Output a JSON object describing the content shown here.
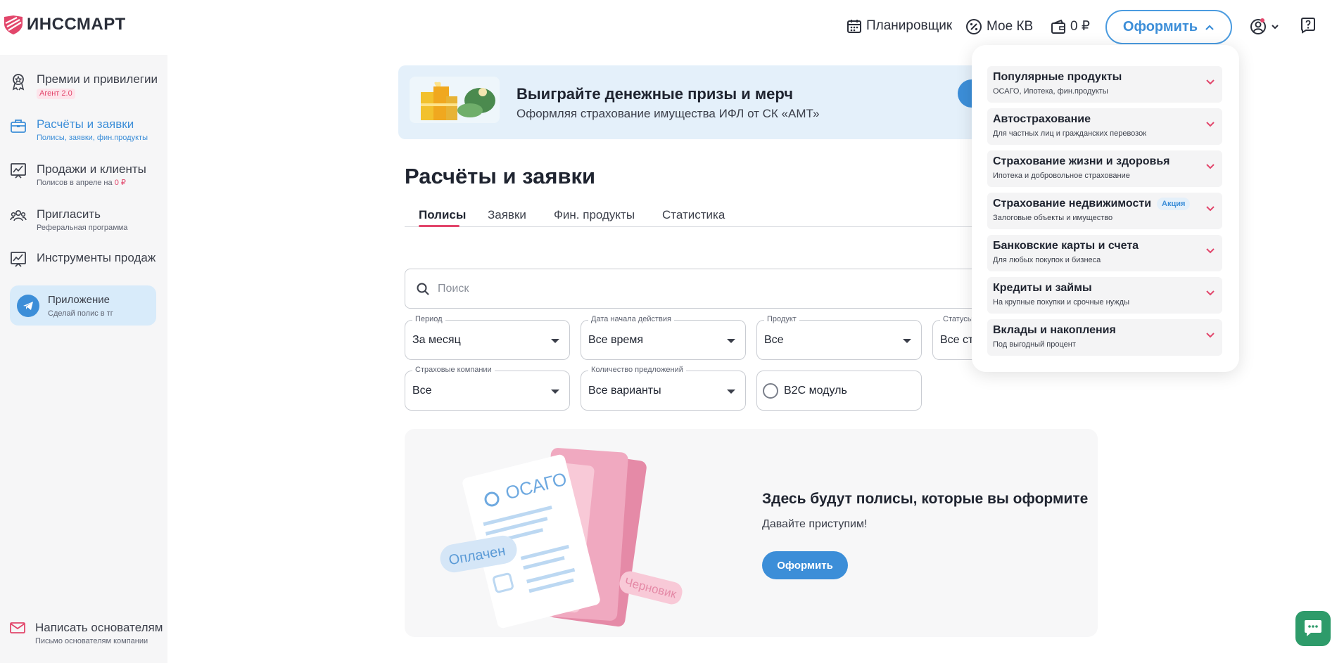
{
  "brand": {
    "name": "ИНССМАРТ",
    "pink": "#e2466b",
    "blue": "#3c8ed8"
  },
  "header": {
    "planner": "Планировщик",
    "my_kv": "Мое КВ",
    "wallet": "0 ₽",
    "oformit": "Оформить"
  },
  "sidebar": {
    "items": [
      {
        "title": "Премии и привилегии",
        "sub": "Агент 2.0"
      },
      {
        "title": "Расчёты и заявки",
        "sub": "Полисы, заявки, фин.продукты"
      },
      {
        "title": "Продажи и клиенты",
        "sub": "Полисов в апреле на",
        "sub_value": "0 ₽"
      },
      {
        "title": "Пригласить",
        "sub": "Реферальная программа"
      },
      {
        "title": "Инструменты продаж",
        "sub": ""
      }
    ],
    "app": {
      "title": "Приложение",
      "sub": "Сделай полис в тг"
    },
    "founders": {
      "title": "Написать основателям",
      "sub": "Письмо основателям компании"
    }
  },
  "banner": {
    "title": "Выиграйте денежные призы и мерч",
    "subtitle": "Оформляя страхование имущества ИФЛ от СК «АМТ»"
  },
  "main": {
    "title": "Расчёты и заявки",
    "tabs": [
      "Полисы",
      "Заявки",
      "Фин. продукты",
      "Статистика"
    ],
    "search_placeholder": "Поиск",
    "filters": [
      {
        "label": "Период",
        "value": "За месяц"
      },
      {
        "label": "Дата начала действия",
        "value": "Все время"
      },
      {
        "label": "Продукт",
        "value": "Все"
      },
      {
        "label": "Статусы",
        "value": "Все ста"
      },
      {
        "label": "Страховые компании",
        "value": "Все"
      },
      {
        "label": "Количество предложений",
        "value": "Все варианты"
      }
    ],
    "b2c_toggle": "B2C модуль",
    "empty": {
      "title": "Здесь будут полисы, которые вы оформите",
      "subtitle": "Давайте приступим!",
      "button": "Оформить",
      "illustration": {
        "card_label": "ОСАГО",
        "paid": "Оплачен",
        "draft": "Черновик"
      }
    }
  },
  "dropdown": {
    "items": [
      {
        "title": "Популярные продукты",
        "sub": "ОСАГО, Ипотека, фин.продукты"
      },
      {
        "title": "Автострахование",
        "sub": "Для частных лиц и гражданских перевозок"
      },
      {
        "title": "Страхование жизни и здоровья",
        "sub": "Ипотека и добровольное страхование"
      },
      {
        "title": "Страхование недвижимости",
        "sub": "Залоговые объекты и имущество",
        "badge": "Акция"
      },
      {
        "title": "Банковские карты и счета",
        "sub": "Для любых покупок и бизнеса"
      },
      {
        "title": "Кредиты и займы",
        "sub": "На крупные покупки и срочные нужды"
      },
      {
        "title": "Вклады и накопления",
        "sub": "Под выгодный процент"
      }
    ]
  }
}
